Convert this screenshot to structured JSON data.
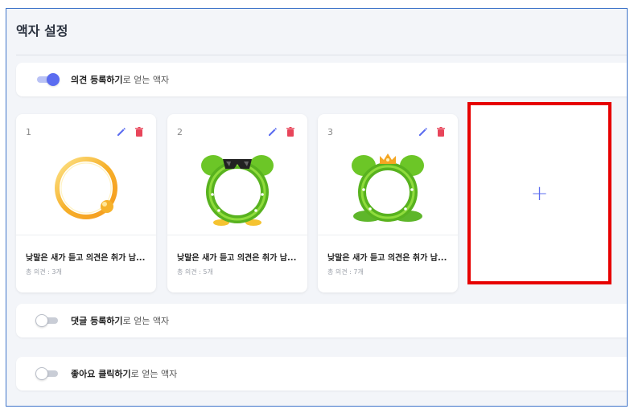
{
  "page": {
    "title": "액자 설정"
  },
  "sections": [
    {
      "strong": "의견 등록하기",
      "rest": "로 얻는 액자",
      "enabled": true
    },
    {
      "strong": "댓글 등록하기",
      "rest": "로 얻는 액자",
      "enabled": false
    },
    {
      "strong": "좋아요 클릭하기",
      "rest": "로 얻는 액자",
      "enabled": false
    }
  ],
  "frames": [
    {
      "number": "1",
      "title": "낮말은 새가 듣고 의견은 취가 남...",
      "count": "총 의견 : 3개",
      "image": "golden-ring-frame"
    },
    {
      "number": "2",
      "title": "낮말은 새가 듣고 의견은 취가 남...",
      "count": "총 의견 : 5개",
      "image": "green-sunglasses-frame"
    },
    {
      "number": "3",
      "title": "낮말은 새가 듣고 의견은 취가 남...",
      "count": "총 의견 : 7개",
      "image": "green-crown-frame"
    }
  ],
  "add_button": {
    "label": "+"
  },
  "colors": {
    "accent": "#5b6cf0",
    "delete": "#e8455a",
    "highlight": "#e60000"
  },
  "icons": {
    "edit": "pencil-icon",
    "delete": "trash-icon",
    "add": "plus-icon"
  }
}
